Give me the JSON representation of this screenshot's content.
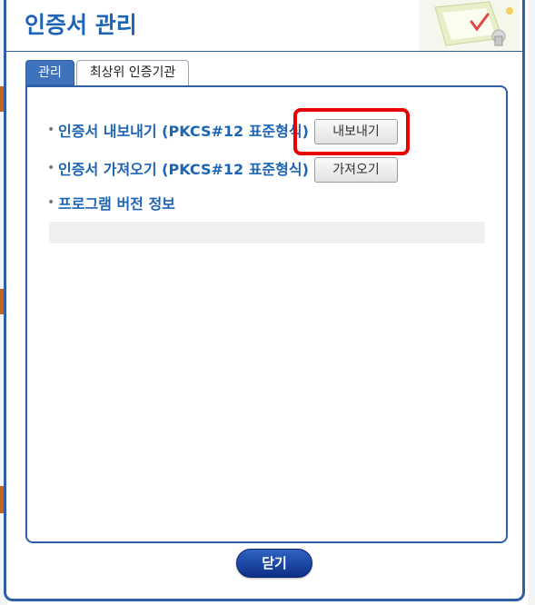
{
  "dialog": {
    "title": "인증서 관리"
  },
  "tabs": [
    {
      "label": "관리",
      "active": true
    },
    {
      "label": "최상위 인증기관",
      "active": false
    }
  ],
  "rows": {
    "export_label": "인증서 내보내기 (PKCS#12 표준형식)",
    "import_label": "인증서 가져오기 (PKCS#12 표준형식)",
    "version_label": "프로그램 버전 정보"
  },
  "buttons": {
    "export": "내보내기",
    "import": "가져오기",
    "close": "닫기"
  },
  "version_info": "",
  "colors": {
    "accent": "#1e64b4",
    "border": "#2e5fa8",
    "highlight": "#e80000",
    "close_button": "#1a3f9c"
  }
}
